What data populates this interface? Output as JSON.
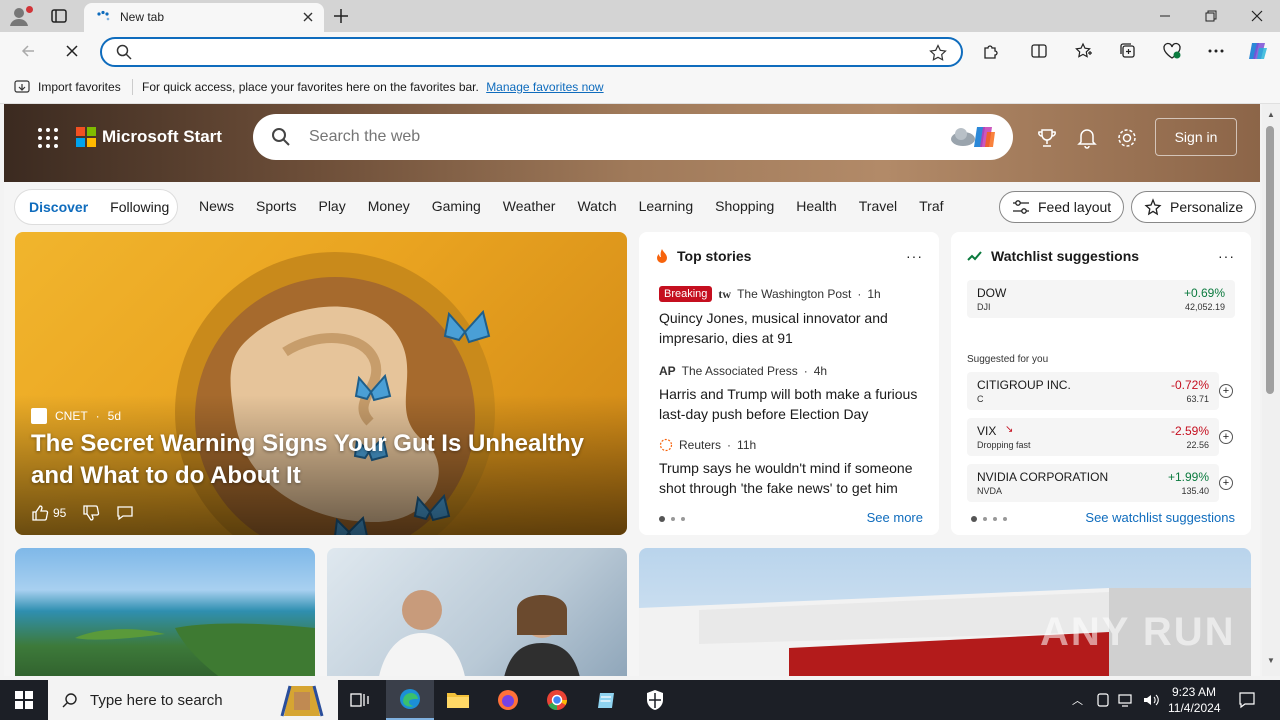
{
  "browser": {
    "tab_title": "New tab",
    "address_value": "",
    "favorites_bar": {
      "import_label": "Import favorites",
      "message": "For quick access, place your favorites here on the favorites bar.",
      "link": "Manage favorites now"
    }
  },
  "header": {
    "brand": "Microsoft Start",
    "search_placeholder": "Search the web",
    "signin_label": "Sign in"
  },
  "nav": {
    "segments": [
      "Discover",
      "Following"
    ],
    "items": [
      "News",
      "Sports",
      "Play",
      "Money",
      "Gaming",
      "Weather",
      "Watch",
      "Learning",
      "Shopping",
      "Health",
      "Travel",
      "Traf"
    ],
    "feed_layout": "Feed layout",
    "personalize": "Personalize"
  },
  "main_story": {
    "source": "CNET",
    "age": "5d",
    "headline": "The Secret Warning Signs Your Gut Is Unhealthy and What to do About It",
    "likes": "95"
  },
  "top_stories": {
    "title": "Top stories",
    "stories": [
      {
        "badge": "Breaking",
        "source": "The Washington Post",
        "age": "1h",
        "headline": "Quincy Jones, musical innovator and impresario, dies at 91"
      },
      {
        "source": "The Associated Press",
        "age": "4h",
        "headline": "Harris and Trump will both make a furious last-day push before Election Day"
      },
      {
        "source": "Reuters",
        "age": "11h",
        "headline": "Trump says he wouldn't mind if someone shot through 'the fake news' to get him"
      }
    ],
    "see_more": "See more"
  },
  "watchlist": {
    "title": "Watchlist suggestions",
    "index": {
      "name": "DOW",
      "ticker": "DJI",
      "change": "+0.69%",
      "price": "42,052.19"
    },
    "suggested_label": "Suggested for you",
    "stocks": [
      {
        "name": "CITIGROUP INC.",
        "ticker": "C",
        "change": "-0.72%",
        "price": "63.71",
        "trend": "down"
      },
      {
        "name": "VIX",
        "ticker": "Dropping fast",
        "change": "-2.59%",
        "price": "22.56",
        "trend": "down"
      },
      {
        "name": "NVIDIA CORPORATION",
        "ticker": "NVDA",
        "change": "+1.99%",
        "price": "135.40",
        "trend": "up"
      }
    ],
    "see_more": "See watchlist suggestions"
  },
  "taskbar": {
    "search_placeholder": "Type here to search",
    "time": "9:23 AM",
    "date": "11/4/2024"
  },
  "watermark": "ANY RUN",
  "colors": {
    "accent": "#0f6cbd",
    "breaking": "#c50f1f",
    "up": "#0b7a3e",
    "down": "#c50f1f"
  }
}
